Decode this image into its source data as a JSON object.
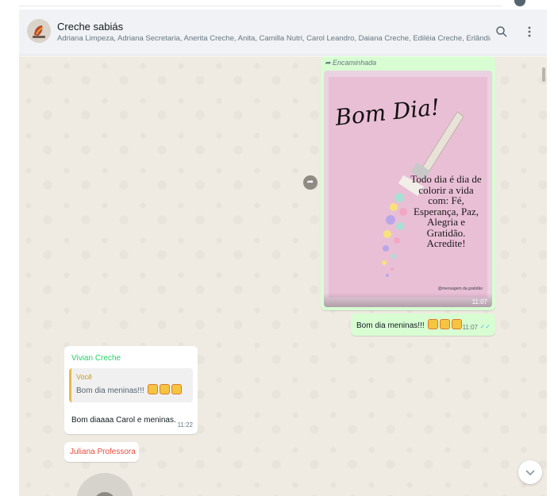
{
  "header": {
    "title": "Creche sabiás",
    "members": "Adriana Limpeza, Adriana Secretaria, Anerita Creche, Anita, Camilla Nutri, Carol Leandro, Daiana Creche, Ediléia Creche, Erlândia Creche, ..."
  },
  "messages": {
    "image": {
      "forwarded_label": "Encaminhada",
      "heading": "Bom Dia!",
      "quote": "Todo dia é dia de colorir a vida com: Fé, Esperança, Paz, Alegria e Gratidão. Acredite!",
      "credit": "@mensagem.da.gratidão",
      "time": "11:07"
    },
    "outgoing_text": {
      "text": "Bom dia meninas!!!",
      "time": "11:07"
    },
    "incoming_reply": {
      "sender": "Vivian Creche",
      "quoted_author": "Você",
      "quoted_text": "Bom dia meninas!!!",
      "text": "Bom diaaaa Carol e meninas.",
      "time": "11:22"
    },
    "incoming_next": {
      "sender": "Juliana Professora"
    }
  },
  "colors": {
    "chat_background": "#efeae2",
    "outgoing_bubble": "#d9fdd3",
    "incoming_bubble": "#ffffff",
    "header_background": "#f0f2f5",
    "sender_vivian": "#25d366",
    "sender_juliana": "#e74c3c",
    "read_ticks": "#53bdeb"
  },
  "icons": [
    "group-avatar-icon",
    "search-icon",
    "menu-icon",
    "forward-icon",
    "share-icon",
    "double-check-icon",
    "scroll-down-icon",
    "emoji-icon"
  ]
}
